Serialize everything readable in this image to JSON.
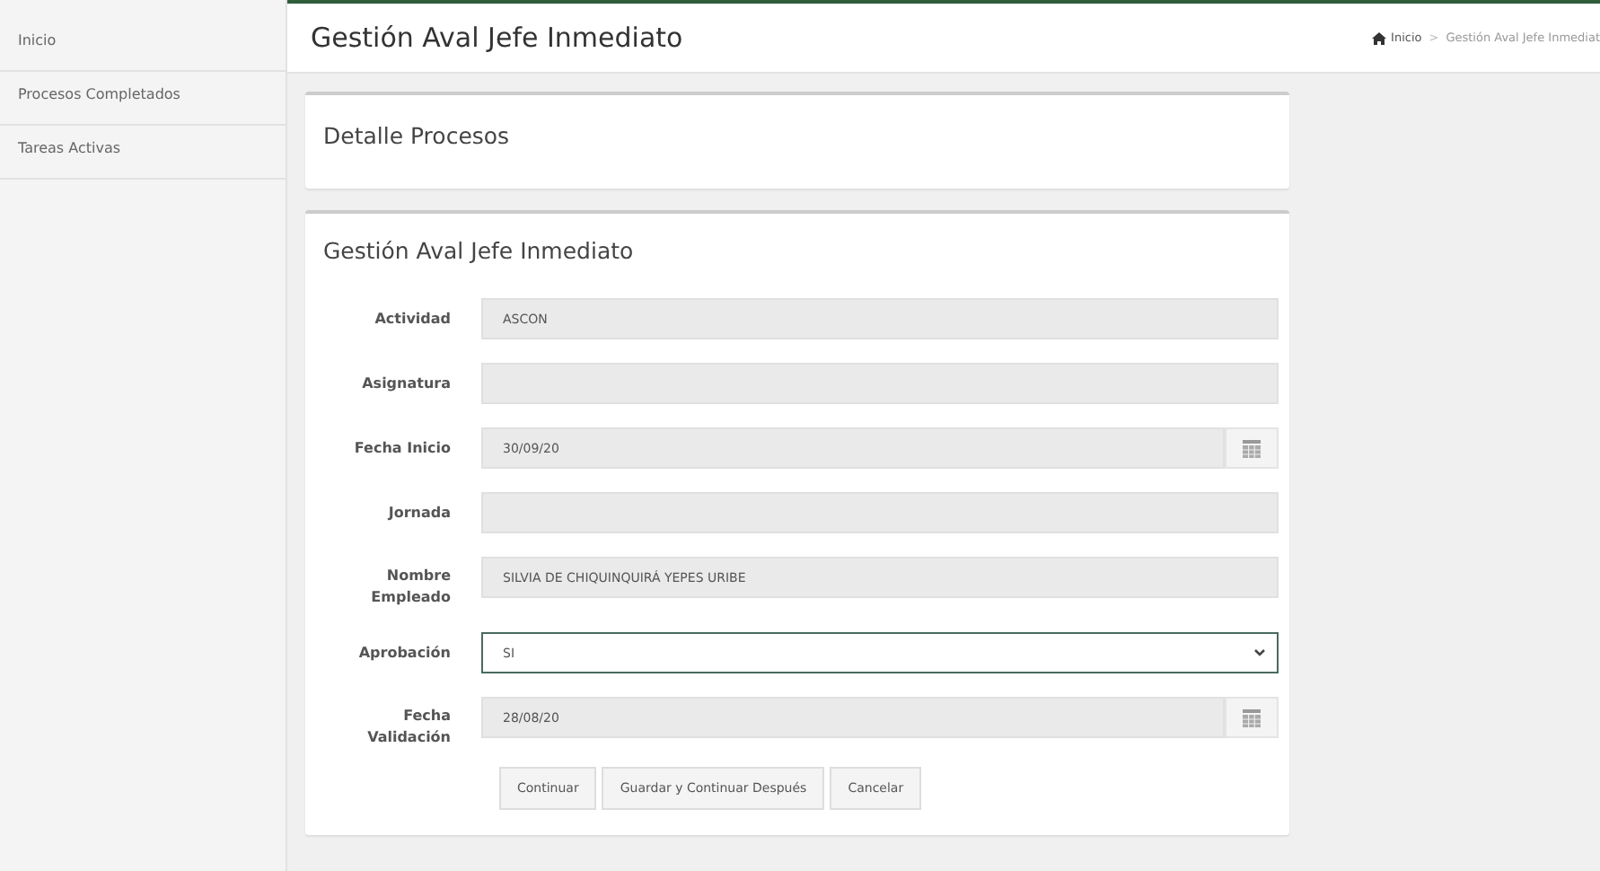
{
  "sidebar": {
    "items": [
      {
        "label": "Inicio"
      },
      {
        "label": "Procesos Completados"
      },
      {
        "label": "Tareas Activas"
      }
    ]
  },
  "header": {
    "title": "Gestión Aval Jefe Inmediato",
    "breadcrumb": [
      "Inicio",
      "Gestión Aval Jefe Inmediat"
    ],
    "breadcrumb_separator": ">"
  },
  "detail_panel": {
    "title": "Detalle Procesos"
  },
  "form_panel": {
    "title": "Gestión Aval Jefe Inmediato",
    "fields": [
      {
        "kind": "text",
        "label": "Actividad",
        "value": "ASCON"
      },
      {
        "kind": "text",
        "label": "Asignatura"
      },
      {
        "kind": "date",
        "label": "Fecha Inicio",
        "value": "30/09/20"
      },
      {
        "kind": "text",
        "label": "Jornada"
      },
      {
        "kind": "text",
        "label": "Nombre Empleado",
        "value": "SILVIA DE CHIQUINQUIRÁ YEPES URIBE"
      },
      {
        "kind": "select",
        "label": "Aprobación",
        "value": "SI"
      },
      {
        "kind": "date",
        "label": "Fecha Validación",
        "value": "28/08/20"
      }
    ],
    "buttons": [
      "Continuar",
      "Guardar y Continuar Después",
      "Cancelar"
    ]
  }
}
